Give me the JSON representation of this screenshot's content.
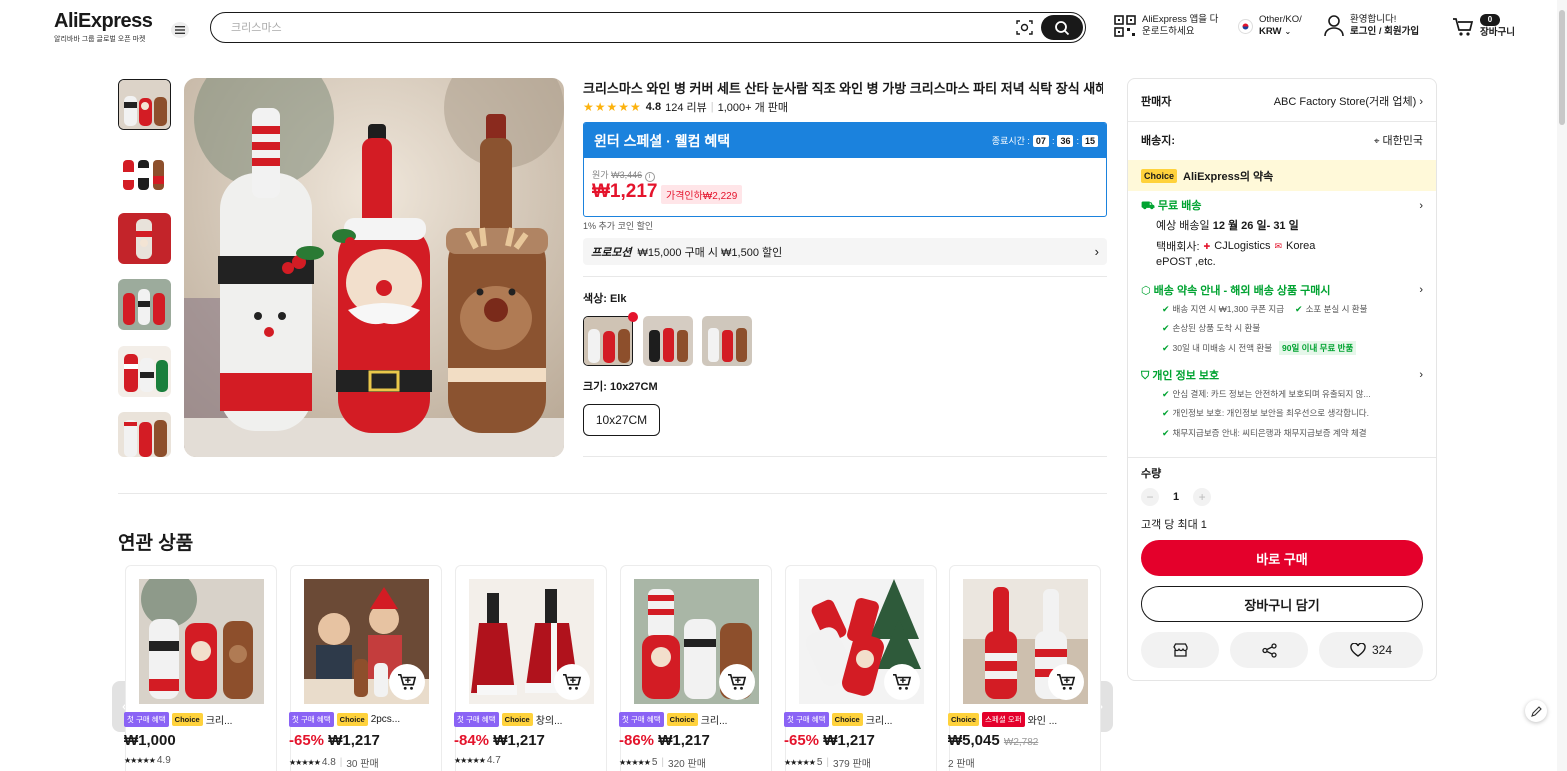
{
  "header": {
    "logo": "AliExpress",
    "logo_sub": "알리바바 그룹 글로벌 오픈 마켓",
    "search_placeholder": "크리스마스",
    "app_line1": "AliExpress 앱을 다",
    "app_line2": "운로드하세요",
    "region_line1": "Other/KO/",
    "region_line2": "KRW",
    "user_line1": "환영합니다!",
    "user_line2": "로그인 / 회원가입",
    "cart_count": "0",
    "cart_label": "장바구니"
  },
  "product": {
    "title": "크리스마스 와인 병 커버 세트 산타 눈사람 직조 와인 병 가방 크리스마스 파티 저녁 식탁 장식 새해 선물",
    "rating": "4.8",
    "reviews": "124 리뷰",
    "sold": "1,000+ 개 판매",
    "banner_title": "윈터 스페셜 · 웰컴 혜택",
    "end_label": "종료시간 :",
    "timer_h": "07",
    "timer_m": "36",
    "timer_s": "15",
    "orig_label": "원가",
    "orig_price": "₩3,446",
    "price": "₩1,217",
    "discount": "가격인하₩2,229",
    "coin": "1% 추가 코인 할인",
    "promo_label": "프로모션",
    "promo_text": "₩15,000 구매 시 ₩1,500 할인",
    "color_label": "색상: Elk",
    "size_label": "크기: 10x27CM",
    "size_option": "10x27CM"
  },
  "panel": {
    "seller_label": "판매자",
    "seller_value": "ABC Factory Store(거래 업체)",
    "ship_label": "배송지:",
    "ship_value": "대한민국",
    "choice_badge": "Choice",
    "choice_text": "AliExpress의 약속",
    "free_ship": "무료 배송",
    "eta_prefix": "예상 배송일 ",
    "eta_dates": "12 월 26 일- 31 일",
    "courier_label": "택배회사: ",
    "courier1": "CJLogistics",
    "courier2": "Korea",
    "courier3": "ePOST ,etc.",
    "promise_title": "배송 약속 안내 - 해외 배송 상품 구매시",
    "promise1": "배송 지연 시 ₩1,300 쿠폰 지급",
    "promise2": "소포 분실 시 환불",
    "promise3": "손상된 상품 도착 시 환불",
    "promise4": "30일 내 미배송 시 전액 환불",
    "promise4_tag": "90일 이내 무료 반품",
    "privacy_title": "개인 정보 보호",
    "privacy1": "안심 결제: 카드 정보는 안전하게 보호되며 유출되지 않...",
    "privacy2": "개인정보 보호: 개인정보 보안을 최우선으로 생각합니다.",
    "privacy3": "채무지급보증 안내: 씨티은행과 채무지급보증 계약 체결",
    "qty_label": "수량",
    "qty": "1",
    "limit": "고객 당 최대 1",
    "buy_now": "바로 구매",
    "add_cart": "장바구니 담기",
    "wish_count": "324"
  },
  "related": {
    "title": "연관 상품",
    "items": [
      {
        "tag1": "첫 구매 혜택",
        "tag2": "Choice",
        "name": "크리...",
        "disc": "",
        "price": "₩1,000",
        "was": "",
        "rating": "4.9",
        "sold": ""
      },
      {
        "tag1": "첫 구매 혜택",
        "tag2": "Choice",
        "name": "2pcs...",
        "disc": "-65%",
        "price": "₩1,217",
        "was": "",
        "rating": "4.8",
        "sold": "30 판매"
      },
      {
        "tag1": "첫 구매 혜택",
        "tag2": "Choice",
        "name": "창의...",
        "disc": "-84%",
        "price": "₩1,217",
        "was": "",
        "rating": "4.7",
        "sold": ""
      },
      {
        "tag1": "첫 구매 혜택",
        "tag2": "Choice",
        "name": "크리...",
        "disc": "-86%",
        "price": "₩1,217",
        "was": "",
        "rating": "5",
        "sold": "320 판매"
      },
      {
        "tag1": "첫 구매 혜택",
        "tag2": "Choice",
        "name": "크리...",
        "disc": "-65%",
        "price": "₩1,217",
        "was": "",
        "rating": "5",
        "sold": "379 판매"
      },
      {
        "tag1": "Choice",
        "tag2": "스페셜 오퍼",
        "name": "와인 ...",
        "disc": "",
        "price": "₩5,045",
        "was": "₩2,782",
        "rating": "",
        "sold": "2 판매"
      }
    ]
  },
  "colors": {
    "accent": "#e4002b",
    "banner": "#1b82dd",
    "choice": "#ffd23c",
    "green": "#00a331"
  }
}
